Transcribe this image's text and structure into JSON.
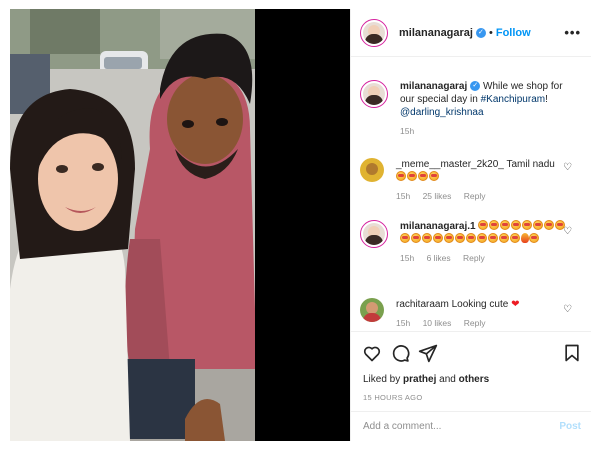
{
  "post": {
    "header": {
      "username": "milananagaraj",
      "separator": "•",
      "follow_label": "Follow",
      "more_label": "•••"
    },
    "caption": {
      "username": "milananagaraj",
      "text": "While we shop for our special day in",
      "hashtag": "#Kanchipuram",
      "punct": "!",
      "mention": "@darling_krishnaa",
      "time": "15h"
    },
    "comments": [
      {
        "username": "_meme__master_2k20_",
        "text": "Tamil nadu",
        "emoji_count": 4,
        "time": "15h",
        "likes": "25 likes",
        "reply": "Reply"
      },
      {
        "username": "milananagaraj.1",
        "text": "",
        "emoji_count": 21,
        "time": "15h",
        "likes": "6 likes",
        "reply": "Reply"
      },
      {
        "username": "rachitaraam",
        "text": "Looking cute",
        "emoji": "❤",
        "time": "15h",
        "likes": "10 likes",
        "reply": "Reply"
      }
    ],
    "likes": {
      "prefix": "Liked by",
      "user": "prathej",
      "and": "and",
      "others": "others"
    },
    "timestamp": "15 HOURS AGO",
    "add_comment": {
      "placeholder": "Add a comment...",
      "post_label": "Post"
    },
    "icons": {
      "like": "heart-icon",
      "comment": "comment-icon",
      "share": "share-icon",
      "save": "bookmark-icon"
    },
    "colors": {
      "link_blue": "#0095f6",
      "verified_blue": "#3897f0",
      "muted_gray": "#8e8e8e",
      "post_disabled": "#b2dffc"
    }
  }
}
